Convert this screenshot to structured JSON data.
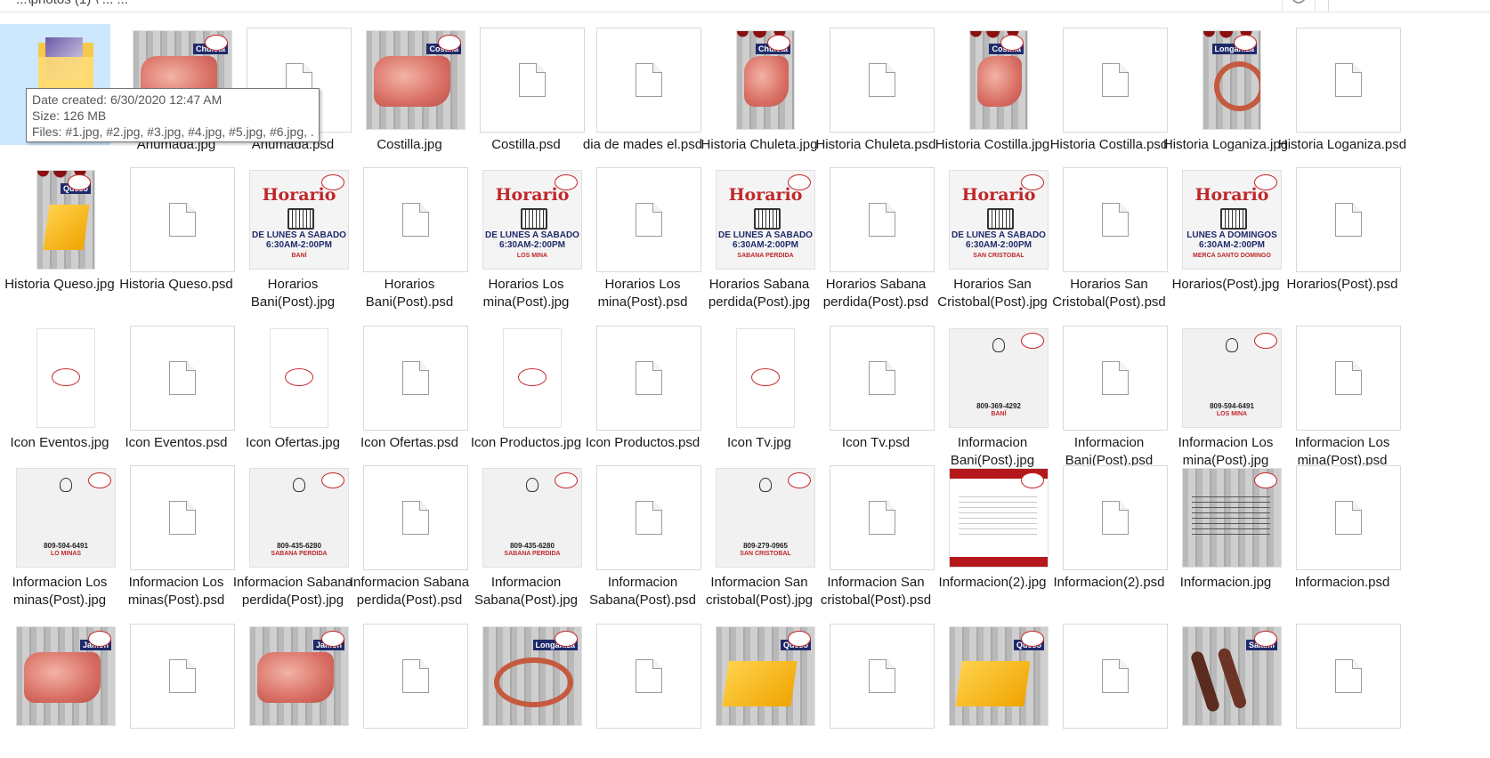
{
  "address_bar": {
    "path_text": "...\\photos (1)  \\ ...  ..."
  },
  "tooltip": {
    "line1": "Date created: 6/30/2020 12:47 AM",
    "line2": "Size: 126 MB",
    "line3": "Files: #1.jpg, #2.jpg, #3.jpg, #4.jpg, #5.jpg, #6.jpg, ..."
  },
  "rows": [
    [
      {
        "label": "",
        "kind": "folder"
      },
      {
        "label": "Ahumada.jpg",
        "kind": "meat",
        "tag": "Chuleta"
      },
      {
        "label": "Ahumada.psd",
        "kind": "blank"
      },
      {
        "label": "Costilla.jpg",
        "kind": "meat",
        "tag": "Costilla"
      },
      {
        "label": "Costilla.psd",
        "kind": "blank"
      },
      {
        "label": "dia de mades el.psd",
        "kind": "blank"
      },
      {
        "label": "Historia Chuleta.jpg",
        "kind": "tallmeat",
        "tag": "Chuleta"
      },
      {
        "label": "Historia Chuleta.psd",
        "kind": "blank"
      },
      {
        "label": "Historia Costilla.jpg",
        "kind": "tallmeat",
        "tag": "Costilla"
      },
      {
        "label": "Historia Costilla.psd",
        "kind": "blank"
      },
      {
        "label": "Historia Loganiza.jpg",
        "kind": "tallsausage",
        "tag": "Longaniza"
      },
      {
        "label": "Historia Loganiza.psd",
        "kind": "blank"
      }
    ],
    [
      {
        "label": "Historia Queso.jpg",
        "kind": "tallcheese",
        "tag": "Queso"
      },
      {
        "label": "Historia Queso.psd",
        "kind": "blank"
      },
      {
        "label": "Horarios Bani(Post).jpg",
        "kind": "horario",
        "heading": "Horario",
        "hours": "DE LUNES A SABADO 6:30AM-2:00PM",
        "city": "BANÍ"
      },
      {
        "label": "Horarios Bani(Post).psd",
        "kind": "blank"
      },
      {
        "label": "Horarios Los mina(Post).jpg",
        "kind": "horario",
        "heading": "Horario",
        "hours": "DE LUNES A SABADO 6:30AM-2:00PM",
        "city": "LOS MINA"
      },
      {
        "label": "Horarios Los mina(Post).psd",
        "kind": "blank"
      },
      {
        "label": "Horarios Sabana perdida(Post).jpg",
        "kind": "horario",
        "heading": "Horario",
        "hours": "DE LUNES A SABADO 6:30AM-2:00PM",
        "city": "SABANA PERDIDA"
      },
      {
        "label": "Horarios Sabana perdida(Post).psd",
        "kind": "blank"
      },
      {
        "label": "Horarios San Cristobal(Post).jpg",
        "kind": "horario",
        "heading": "Horario",
        "hours": "DE LUNES A SABADO 6:30AM-2:00PM",
        "city": "SAN CRISTOBAL"
      },
      {
        "label": "Horarios San Cristobal(Post).psd",
        "kind": "blank"
      },
      {
        "label": "Horarios(Post).jpg",
        "kind": "horario",
        "heading": "Horario",
        "hours": "LUNES A DOMINGOS 6:30AM-2:00PM",
        "city": "MERCA SANTO DOMINGO"
      },
      {
        "label": "Horarios(Post).psd",
        "kind": "blank"
      }
    ],
    [
      {
        "label": "Icon Eventos.jpg",
        "kind": "icontile"
      },
      {
        "label": "Icon Eventos.psd",
        "kind": "blank"
      },
      {
        "label": "Icon Ofertas.jpg",
        "kind": "icontile"
      },
      {
        "label": "Icon Ofertas.psd",
        "kind": "blank"
      },
      {
        "label": "Icon Productos.jpg",
        "kind": "icontile"
      },
      {
        "label": "Icon Productos.psd",
        "kind": "blank"
      },
      {
        "label": "Icon Tv.jpg",
        "kind": "icontile"
      },
      {
        "label": "Icon Tv.psd",
        "kind": "blank"
      },
      {
        "label": "Informacion Bani(Post).jpg",
        "kind": "info",
        "phone": "809-369-4292",
        "city": "BANÍ"
      },
      {
        "label": "Informacion Bani(Post).psd",
        "kind": "blank"
      },
      {
        "label": "Informacion Los mina(Post).jpg",
        "kind": "info",
        "phone": "809-594-6491",
        "city": "LOS MINA"
      },
      {
        "label": "Informacion Los mina(Post).psd",
        "kind": "blank"
      }
    ],
    [
      {
        "label": "Informacion Los minas(Post).jpg",
        "kind": "info",
        "phone": "809-594-6491",
        "city": "LO MINAS"
      },
      {
        "label": "Informacion Los minas(Post).psd",
        "kind": "blank"
      },
      {
        "label": "Informacion Sabana perdida(Post).jpg",
        "kind": "info",
        "phone": "809-435-6280",
        "city": "SABANA PERDIDA"
      },
      {
        "label": "Informacion Sabana perdida(Post).psd",
        "kind": "blank"
      },
      {
        "label": "Informacion Sabana(Post).jpg",
        "kind": "info",
        "phone": "809-435-6280",
        "city": "SABANA PERDIDA"
      },
      {
        "label": "Informacion Sabana(Post).psd",
        "kind": "blank"
      },
      {
        "label": "Informacion San cristobal(Post).jpg",
        "kind": "info",
        "phone": "809-279-0965",
        "city": "SAN CRISTOBAL"
      },
      {
        "label": "Informacion San cristobal(Post).psd",
        "kind": "blank"
      },
      {
        "label": "Informacion(2).jpg",
        "kind": "red"
      },
      {
        "label": "Informacion(2).psd",
        "kind": "blank"
      },
      {
        "label": "Informacion.jpg",
        "kind": "greywood"
      },
      {
        "label": "Informacion.psd",
        "kind": "blank"
      }
    ],
    [
      {
        "label": "",
        "kind": "meat",
        "tag": "Jamón"
      },
      {
        "label": "",
        "kind": "blank"
      },
      {
        "label": "",
        "kind": "meat",
        "tag": "Jamón"
      },
      {
        "label": "",
        "kind": "blank"
      },
      {
        "label": "",
        "kind": "sausage",
        "tag": "Longaniza"
      },
      {
        "label": "",
        "kind": "blank"
      },
      {
        "label": "",
        "kind": "cheese",
        "tag": "Queso"
      },
      {
        "label": "",
        "kind": "blank"
      },
      {
        "label": "",
        "kind": "cheese",
        "tag": "Queso"
      },
      {
        "label": "",
        "kind": "blank"
      },
      {
        "label": "",
        "kind": "salami",
        "tag": "Salami"
      },
      {
        "label": "",
        "kind": "blank"
      }
    ]
  ]
}
